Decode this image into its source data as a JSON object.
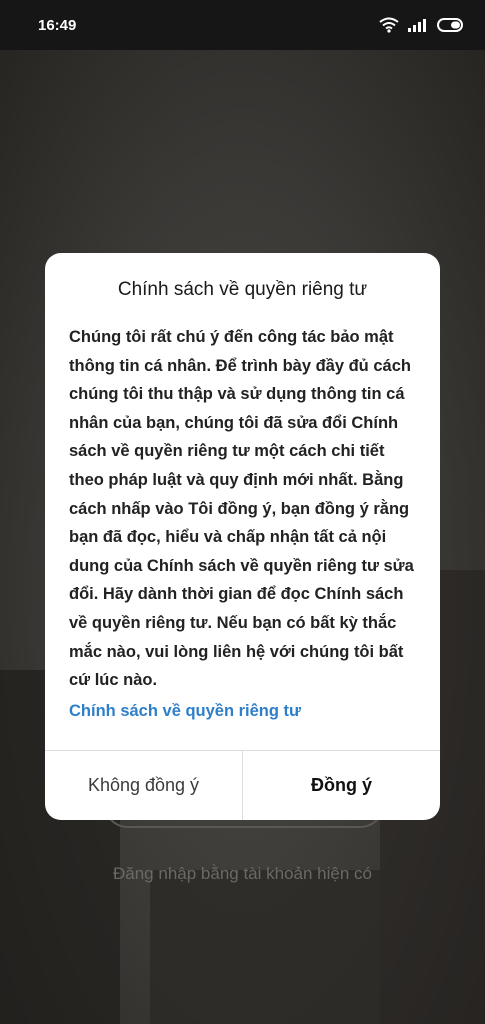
{
  "status_bar": {
    "time": "16:49",
    "icons": [
      "wifi-icon",
      "signal-icon",
      "battery-icon"
    ]
  },
  "background": {
    "login_existing_text": "Đăng nhập bằng tài khoản hiện có"
  },
  "dialog": {
    "title": "Chính sách về quyền riêng tư",
    "body": "Chúng tôi rất chú ý đến công tác bảo mật thông tin cá nhân. Để trình bày đầy đủ cách chúng tôi thu thập và sử dụng thông tin cá nhân của bạn, chúng tôi đã sửa đổi Chính sách về quyền riêng tư một cách chi tiết theo pháp luật và quy định mới nhất. Bằng cách nhấp vào Tôi đồng ý, bạn đồng ý rằng bạn đã đọc, hiểu và chấp nhận tất cả nội dung của Chính sách về quyền riêng tư sửa đổi. Hãy dành thời gian để đọc Chính sách về quyền riêng tư. Nếu bạn có bất kỳ thắc mắc nào, vui lòng liên hệ với chúng tôi bất cứ lúc nào.",
    "link_label": "Chính sách về quyền riêng tư",
    "disagree_label": "Không đồng ý",
    "agree_label": "Đồng ý"
  },
  "colors": {
    "link": "#2f7fc8",
    "dialog_background": "#ffffff",
    "status_bar": "#161616"
  }
}
